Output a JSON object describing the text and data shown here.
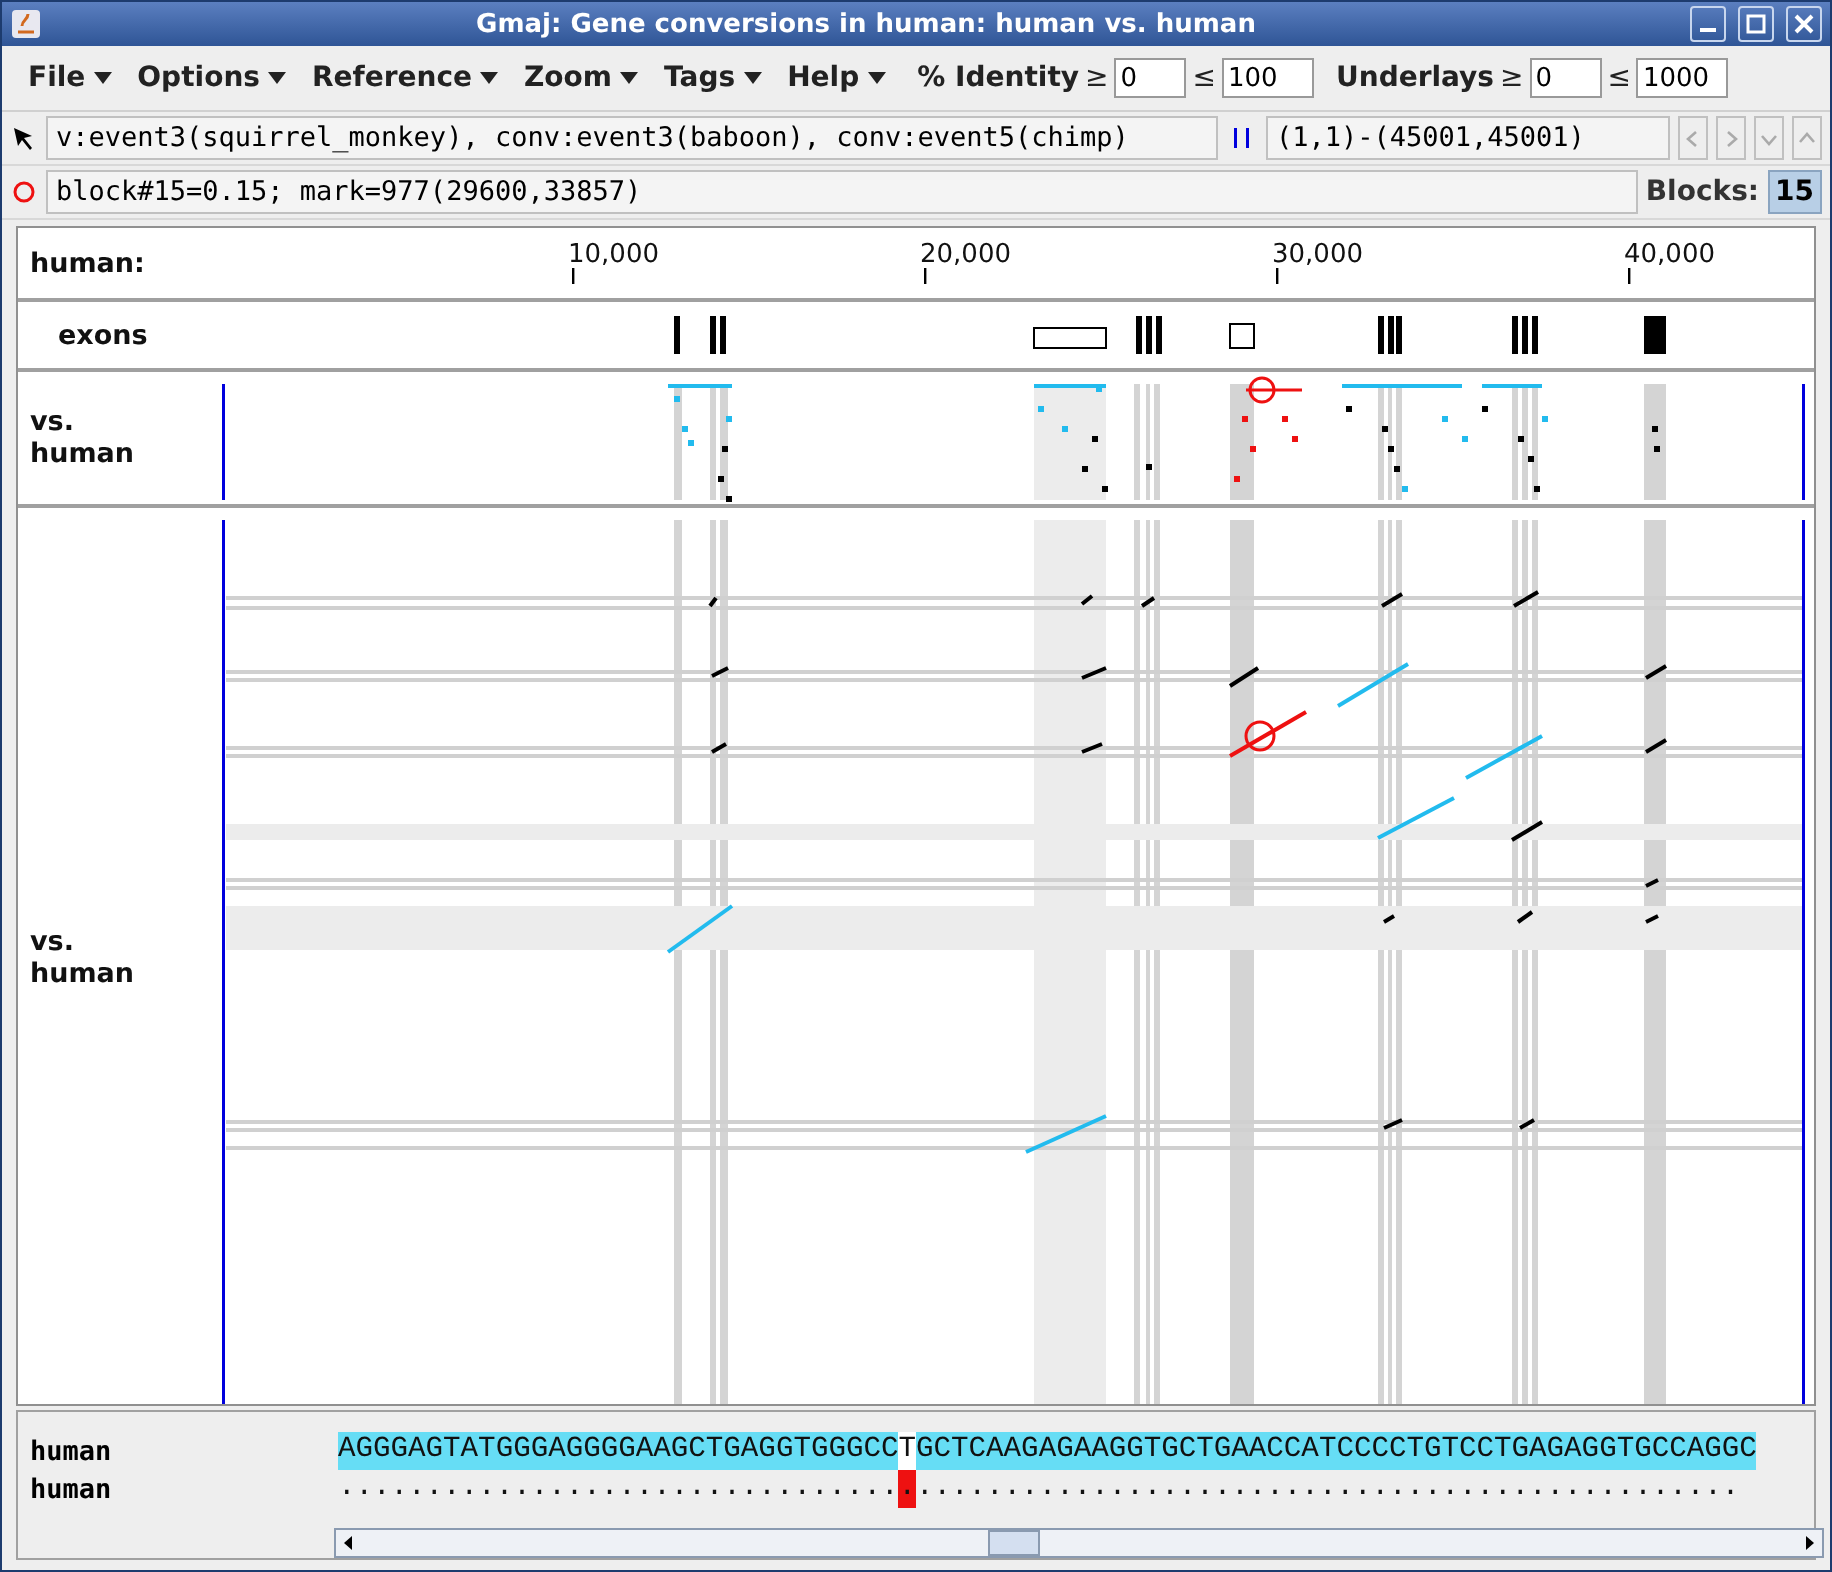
{
  "window": {
    "title": "Gmaj: Gene conversions in human: human vs. human"
  },
  "menus": [
    {
      "label": "File"
    },
    {
      "label": "Options"
    },
    {
      "label": "Reference"
    },
    {
      "label": "Zoom"
    },
    {
      "label": "Tags"
    },
    {
      "label": "Help"
    }
  ],
  "filters": [
    {
      "label": "% Identity",
      "ge": "≥",
      "min": "0",
      "le": "≤",
      "max": "100"
    },
    {
      "label": "Underlays",
      "ge": "≥",
      "min": "0",
      "le": "≤",
      "max": "1000"
    }
  ],
  "tags_field": {
    "value": "v:event3(squirrel_monkey), conv:event3(baboon), conv:event5(chimp)"
  },
  "view_range": {
    "value": "(1,1)-(45001,45001)"
  },
  "status_field": {
    "value": "block#15=0.15; mark=977(29600,33857)"
  },
  "blocks": {
    "label": "Blocks:",
    "count": "15"
  },
  "ruler": {
    "label": "human:",
    "ticks": [
      "10,000",
      "20,000",
      "30,000",
      "40,000"
    ]
  },
  "exon_track": {
    "label": "exons"
  },
  "plots": [
    {
      "label": "vs. human"
    },
    {
      "label": "vs. human"
    }
  ],
  "alignment": {
    "rows": [
      {
        "name": "human",
        "before": "AGGGAGTATGGGAGGGGAAGCTGAGGTGGGCC",
        "mark": "T",
        "after": "GCTCAAGAGAAGGTGCTGAACCATCCCCTGTCCTGAGAGGTGCCAGGC"
      },
      {
        "name": "human",
        "before": "................................",
        "mark": ".",
        "after": "..............................................."
      }
    ]
  }
}
